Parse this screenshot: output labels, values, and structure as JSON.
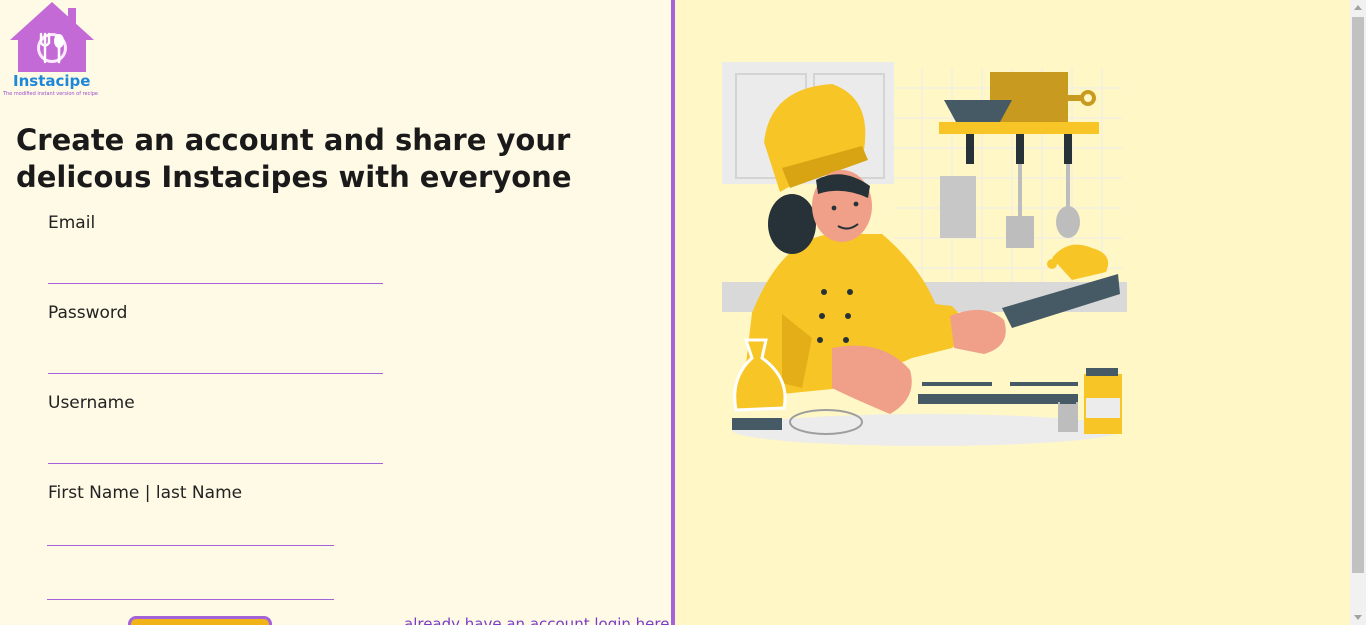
{
  "brand": {
    "name": "Instacipe",
    "tagline": "The modified instant version of recipe"
  },
  "headline": "Create an account and share your delicous Instacipes with everyone",
  "form": {
    "email_label": "Email",
    "password_label": "Password",
    "username_label": "Username",
    "name_label": "First Name | last Name",
    "submit_label": "",
    "login_link": "already have an account login here"
  },
  "colors": {
    "left_bg": "#fffae6",
    "right_bg": "#fff7c5",
    "accent": "#a463d8",
    "brand_blue": "#1e88d8",
    "button": "#f0b418"
  },
  "icons": {
    "logo": "house-fork-spoon-icon",
    "illustration": "chef-cooking-illustration"
  }
}
